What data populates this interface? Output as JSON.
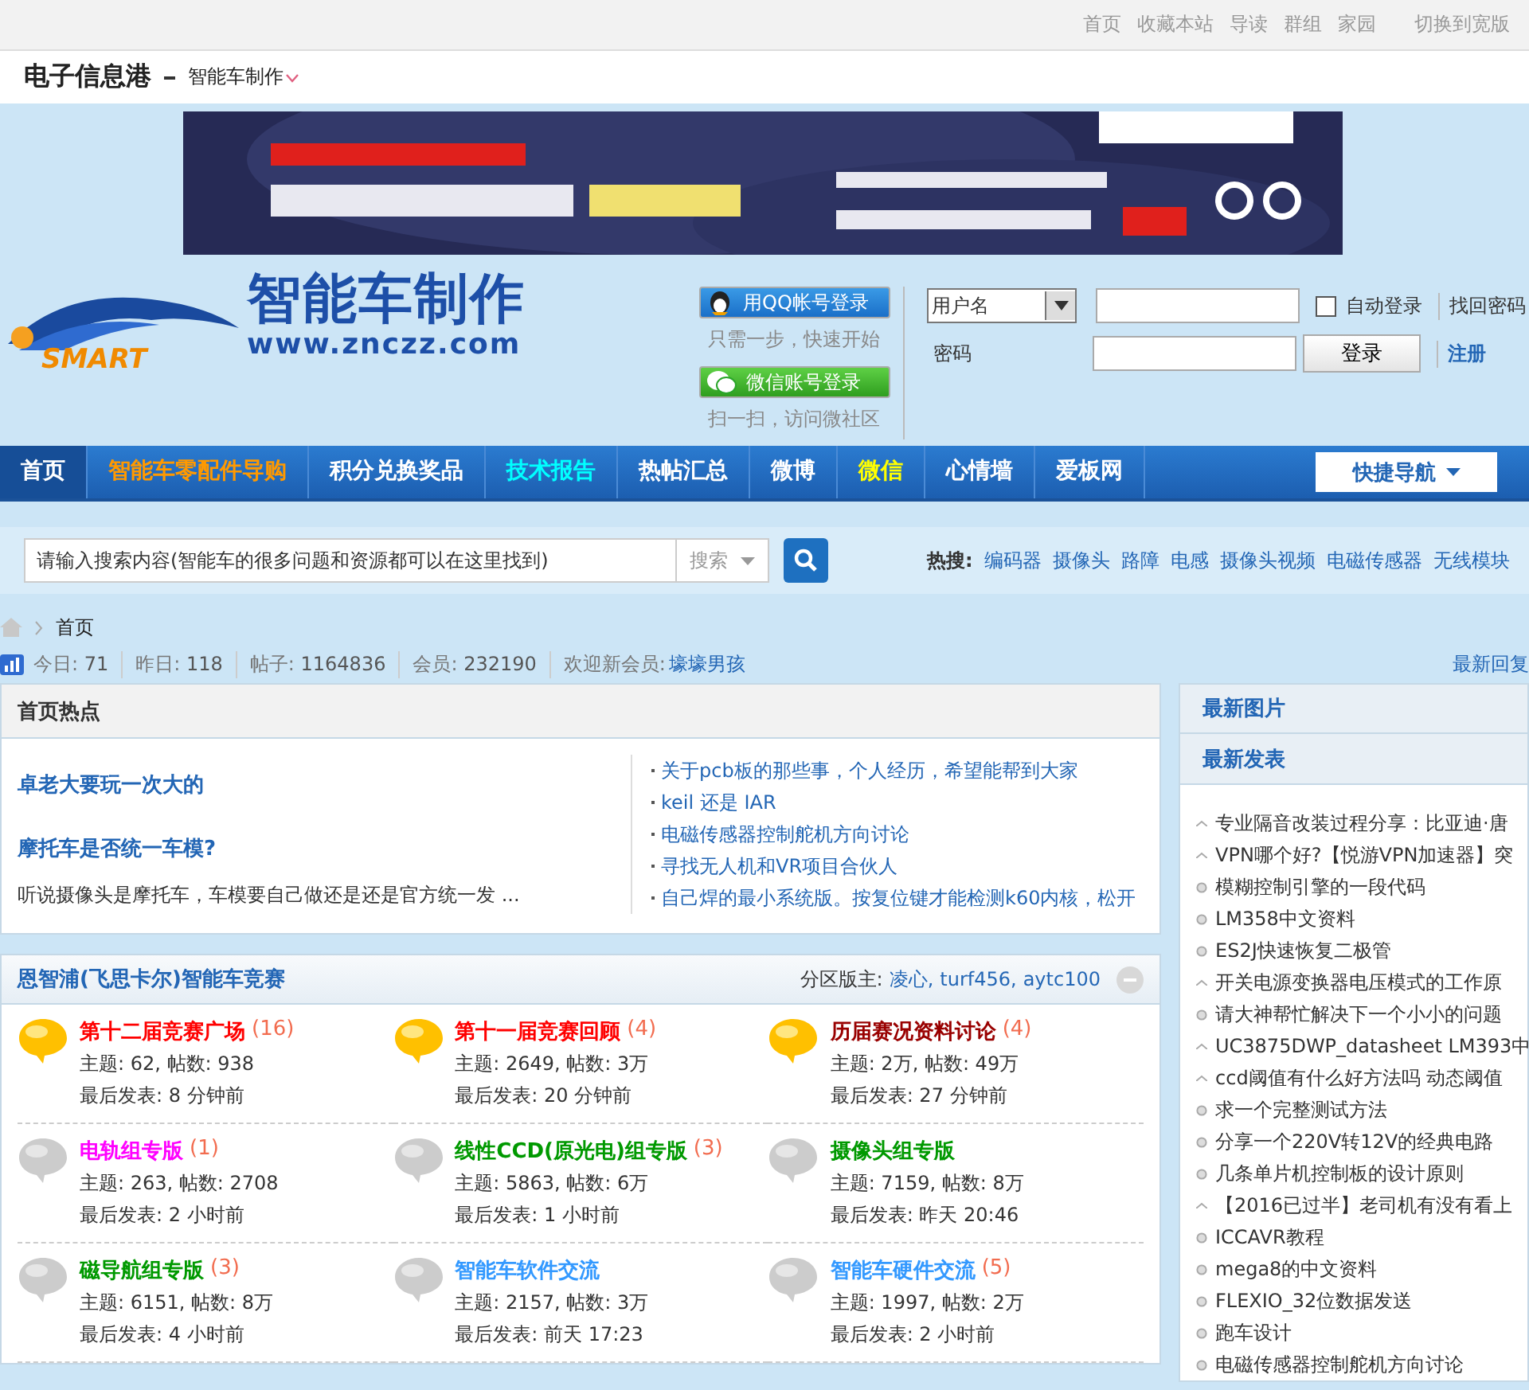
{
  "top_links": [
    "首页",
    "收藏本站",
    "导读",
    "群组",
    "家园",
    "切换到宽版"
  ],
  "site": {
    "name": "电子信息港",
    "section": "智能车制作"
  },
  "banner": {
    "kind": "picture"
  },
  "logo": {
    "title": "智能车制作",
    "url": "www.znczz.com",
    "badge": "SMART"
  },
  "social_login": [
    {
      "kind": "qq",
      "label": "用QQ帐号登录",
      "hint": "只需一步，快速开始"
    },
    {
      "kind": "wechat",
      "label": "微信账号登录",
      "hint": "扫一扫，访问微社区"
    }
  ],
  "login": {
    "account_type": "用户名",
    "password_label": "密码",
    "auto_login": {
      "label": "自动登录",
      "checked": false
    },
    "submit": "登录",
    "forgot": "找回密码",
    "register": "注册"
  },
  "nav": [
    {
      "label": "首页",
      "selected": true,
      "color": "#ffffff"
    },
    {
      "label": "智能车零配件导购",
      "selected": false,
      "color": "#ff9900"
    },
    {
      "label": "积分兑换奖品",
      "selected": false,
      "color": "#ffffff"
    },
    {
      "label": "技术报告",
      "selected": false,
      "color": "#00ffff"
    },
    {
      "label": "热帖汇总",
      "selected": false,
      "color": "#ffffff"
    },
    {
      "label": "微博",
      "selected": false,
      "color": "#ffffff"
    },
    {
      "label": "微信",
      "selected": false,
      "color": "#ffff00"
    },
    {
      "label": "心情墙",
      "selected": false,
      "color": "#ffffff"
    },
    {
      "label": "爱板网",
      "selected": false,
      "color": "#ffffff"
    }
  ],
  "quick_nav": "快捷导航",
  "search": {
    "placeholder": "请输入搜索内容(智能车的很多问题和资源都可以在这里找到)",
    "scope": "搜索"
  },
  "hot_search": {
    "label": "热搜:",
    "terms": [
      "编码器",
      "摄像头",
      "路障",
      "电感",
      "摄像头视频",
      "电磁传感器",
      "无线模块"
    ]
  },
  "breadcrumb": [
    "首页"
  ],
  "stats": [
    {
      "label": "今日:",
      "value": "71"
    },
    {
      "label": "昨日:",
      "value": "118"
    },
    {
      "label": "帖子:",
      "value": "1164836"
    },
    {
      "label": "会员:",
      "value": "232190"
    }
  ],
  "new_member": {
    "label": "欢迎新会员:",
    "name": "壕壕男孩"
  },
  "latest_replies": "最新回复",
  "hot": {
    "title": "首页热点",
    "featured": [
      {
        "title": "卓老大要玩一次大的"
      },
      {
        "title": "摩托车是否统一车模?",
        "summary": "听说摄像头是摩托车，车模要自己做还是还是官方统一发 ..."
      }
    ],
    "links": [
      "关于pcb板的那些事，个人经历，希望能帮到大家",
      "keil 还是  IAR",
      "电磁传感器控制舵机方向讨论",
      "寻找无人机和VR项目合伙人",
      "自己焊的最小系统版。按复位键才能检测k60内核，松开"
    ]
  },
  "category": {
    "title": "恩智浦(飞思卡尔)智能车竞赛",
    "moderator_label": "分区版主:",
    "moderators": [
      "凌心,",
      "turf456,",
      "aytc100"
    ],
    "forums": [
      {
        "name": "第十二届竞赛广场",
        "color": "#ff0000",
        "count": "(16)",
        "new": true,
        "stats": "主题: 62, 帖数: 938",
        "last": "最后发表: 8 分钟前"
      },
      {
        "name": "第十一届竞赛回顾",
        "color": "#ff0000",
        "count": "(4)",
        "new": true,
        "stats": "主题: 2649, 帖数: 3万",
        "last": "最后发表: 20 分钟前"
      },
      {
        "name": "历届赛况资料讨论",
        "color": "#990000",
        "count": "(4)",
        "new": true,
        "stats": "主题: 2万, 帖数: 49万",
        "last": "最后发表: 27 分钟前"
      },
      {
        "name": "电轨组专版",
        "color": "#ff00ff",
        "count": "(1)",
        "new": false,
        "stats": "主题: 263, 帖数: 2708",
        "last": "最后发表: 2 小时前"
      },
      {
        "name": "线性CCD(原光电)组专版",
        "color": "#009900",
        "count": "(3)",
        "new": false,
        "stats": "主题: 5863, 帖数: 6万",
        "last": "最后发表: 1 小时前"
      },
      {
        "name": "摄像头组专版",
        "color": "#009900",
        "new": false,
        "stats": "主题: 7159, 帖数: 8万",
        "last": "最后发表: 昨天 20:46"
      },
      {
        "name": "磁导航组专版",
        "color": "#009900",
        "count": "(3)",
        "new": false,
        "stats": "主题: 6151, 帖数: 8万",
        "last": "最后发表: 4 小时前"
      },
      {
        "name": "智能车软件交流",
        "color": "#3399ff",
        "new": false,
        "stats": "主题: 2157, 帖数: 3万",
        "last": "最后发表: 前天 17:23"
      },
      {
        "name": "智能车硬件交流",
        "color": "#3399ff",
        "count": "(5)",
        "new": false,
        "stats": "主题: 1997, 帖数: 2万",
        "last": "最后发表: 2 小时前"
      }
    ]
  },
  "sidebar": {
    "images_title": "最新图片",
    "posts_title": "最新发表",
    "posts": [
      {
        "kind": "caret",
        "title": "专业隔音改装过程分享：比亚迪·唐"
      },
      {
        "kind": "caret",
        "title": "VPN哪个好?【悦游VPN加速器】突"
      },
      {
        "kind": "dot",
        "title": "模糊控制引擎的一段代码"
      },
      {
        "kind": "dot",
        "title": "LM358中文资料"
      },
      {
        "kind": "dot",
        "title": "ES2J快速恢复二极管"
      },
      {
        "kind": "caret",
        "title": "开关电源变换器电压模式的工作原"
      },
      {
        "kind": "dot",
        "title": "请大神帮忙解决下一个小小的问题"
      },
      {
        "kind": "caret",
        "title": "UC3875DWP_datasheet LM393中"
      },
      {
        "kind": "caret",
        "title": "ccd阈值有什么好方法吗 动态阈值"
      },
      {
        "kind": "dot",
        "title": "求一个完整测试方法"
      },
      {
        "kind": "dot",
        "title": "分享一个220V转12V的经典电路"
      },
      {
        "kind": "dot",
        "title": "几条单片机控制板的设计原则"
      },
      {
        "kind": "caret",
        "title": "【2016已过半】老司机有没有看上"
      },
      {
        "kind": "dot",
        "title": "ICCAVR教程"
      },
      {
        "kind": "dot",
        "title": "mega8的中文资料"
      },
      {
        "kind": "dot",
        "title": "FLEXIO_32位数据发送"
      },
      {
        "kind": "dot",
        "title": "跑车设计"
      },
      {
        "kind": "dot",
        "title": "电磁传感器控制舵机方向讨论"
      }
    ]
  }
}
